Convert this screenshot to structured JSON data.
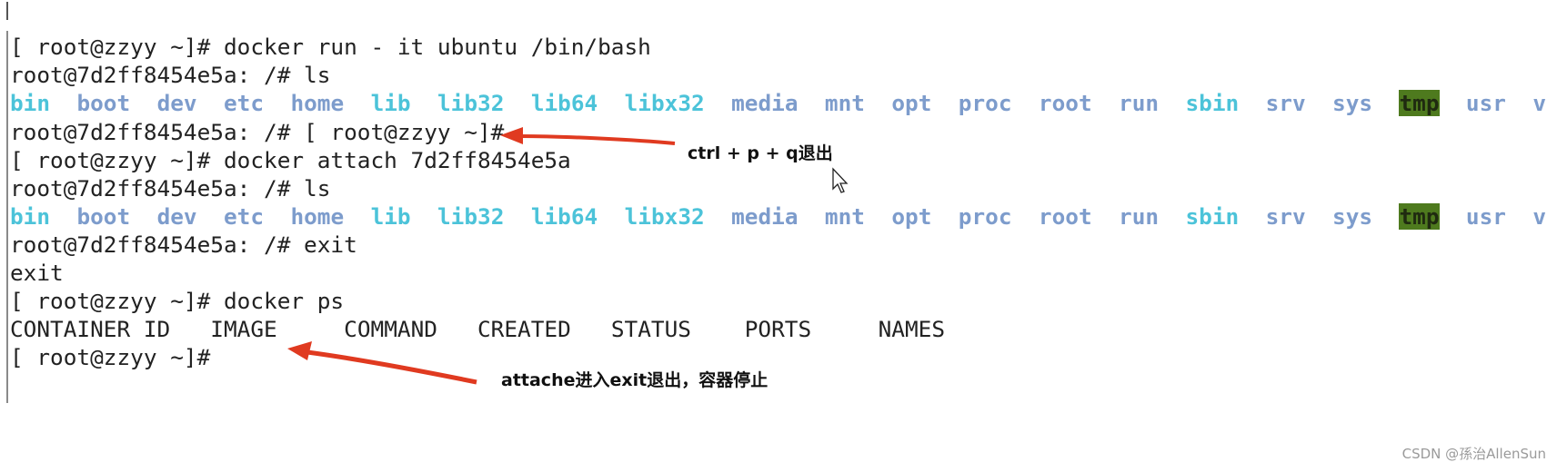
{
  "terminal": {
    "lines": [
      "[ root@zzyy ~]# docker run - it ubuntu /bin/bash",
      "root@7d2ff8454e5a: /# ls",
      "",
      "root@7d2ff8454e5a: /# [ root@zzyy ~]#",
      "[ root@zzyy ~]# docker attach 7d2ff8454e5a",
      "root@7d2ff8454e5a: /# ls",
      "",
      "root@7d2ff8454e5a: /# exit",
      "exit",
      "[ root@zzyy ~]# docker ps",
      "",
      "[ root@zzyy ~]#"
    ],
    "ls_entries": [
      {
        "name": "bin",
        "type": "link"
      },
      {
        "name": "boot",
        "type": "dir"
      },
      {
        "name": "dev",
        "type": "dir"
      },
      {
        "name": "etc",
        "type": "dir"
      },
      {
        "name": "home",
        "type": "dir"
      },
      {
        "name": "lib",
        "type": "link"
      },
      {
        "name": "lib32",
        "type": "link"
      },
      {
        "name": "lib64",
        "type": "link"
      },
      {
        "name": "libx32",
        "type": "link"
      },
      {
        "name": "media",
        "type": "dir"
      },
      {
        "name": "mnt",
        "type": "dir"
      },
      {
        "name": "opt",
        "type": "dir"
      },
      {
        "name": "proc",
        "type": "dir"
      },
      {
        "name": "root",
        "type": "dir"
      },
      {
        "name": "run",
        "type": "dir"
      },
      {
        "name": "sbin",
        "type": "link"
      },
      {
        "name": "srv",
        "type": "dir"
      },
      {
        "name": "sys",
        "type": "dir"
      },
      {
        "name": "tmp",
        "type": "sticky"
      },
      {
        "name": "usr",
        "type": "dir"
      },
      {
        "name": "v",
        "type": "dir"
      }
    ],
    "ps_headers": [
      "CONTAINER ID",
      "IMAGE",
      "COMMAND",
      "CREATED",
      "STATUS",
      "PORTS",
      "NAMES"
    ]
  },
  "annotations": {
    "note1": "ctrl + p + q退出",
    "note2": "attache进入exit退出，容器停止",
    "arrow_color": "#e03a20"
  },
  "colors": {
    "link": "#4cc3d9",
    "dir": "#7d9ccc",
    "sticky_bg": "#4e7a1e"
  },
  "watermark": "CSDN @孫治AllenSun"
}
